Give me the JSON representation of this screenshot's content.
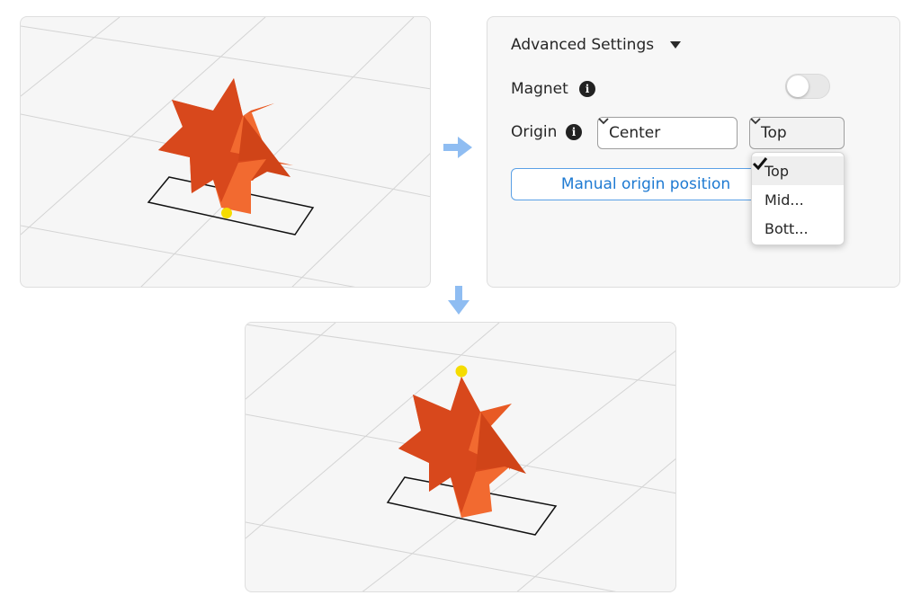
{
  "settings": {
    "title": "Advanced Settings",
    "magnet_label": "Magnet",
    "magnet_enabled": false,
    "origin_label": "Origin",
    "origin_value": "Center",
    "position_value": "Top",
    "manual_button_label": "Manual origin position",
    "position_options": [
      {
        "label": "Top",
        "selected": true
      },
      {
        "label": "Mid...",
        "selected": false
      },
      {
        "label": "Bott...",
        "selected": false
      }
    ]
  },
  "icons": {
    "info": "info-icon",
    "dropdown": "chevron-down-icon",
    "check": "check-icon",
    "flow_right": "arrow-right-icon",
    "flow_down": "arrow-down-icon"
  },
  "colors": {
    "shape_front": "#d8481c",
    "shape_side": "#f26a30",
    "origin_marker": "#f5dc00",
    "flow_arrow": "#8fbdf2",
    "link_blue": "#1e7ad2"
  }
}
